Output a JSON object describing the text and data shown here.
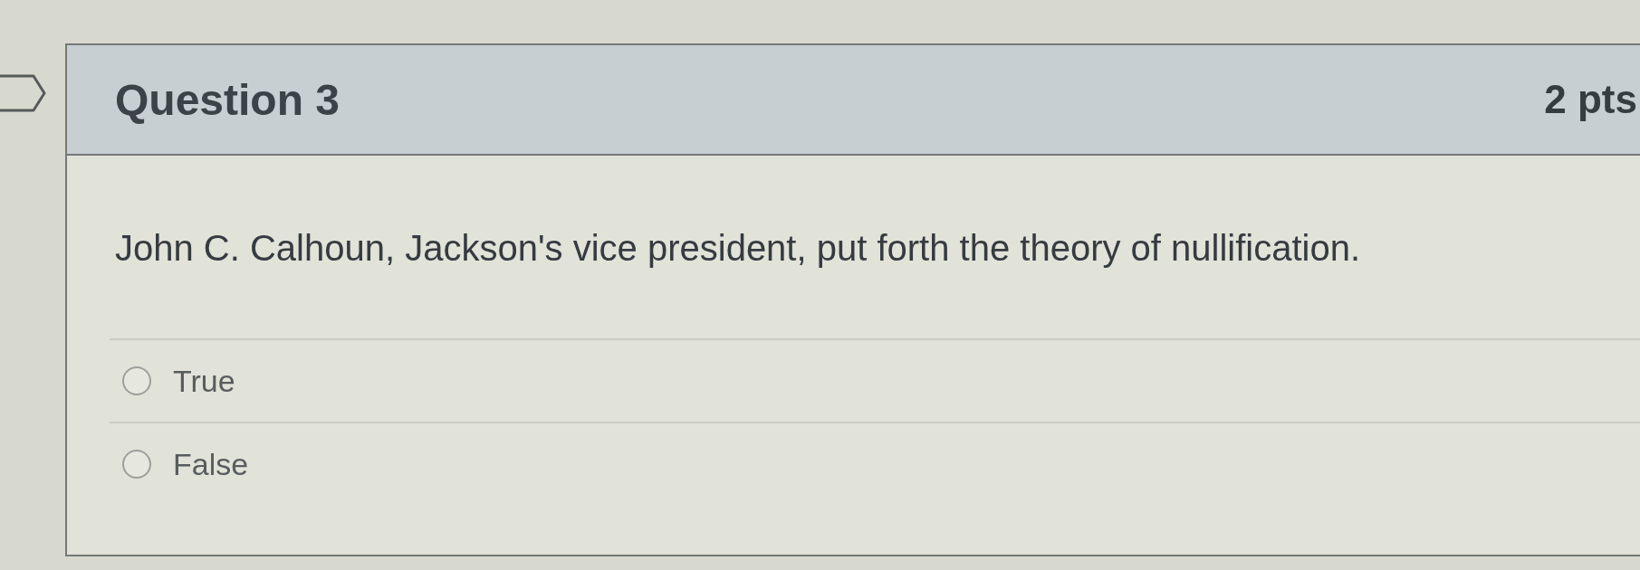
{
  "question": {
    "flagged": false,
    "title": "Question 3",
    "points": "2 pts",
    "text": "John C. Calhoun, Jackson's vice president, put forth the theory of nullification."
  },
  "answers": [
    {
      "label": "True",
      "selected": false
    },
    {
      "label": "False",
      "selected": false
    }
  ]
}
